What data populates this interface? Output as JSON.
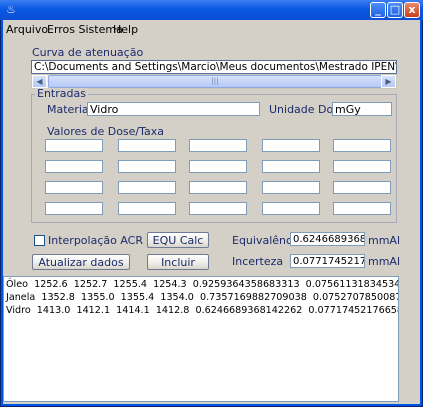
{
  "window": {
    "title": "",
    "icon": "java-cup-icon",
    "controls": {
      "minimize": "_",
      "maximize": "□",
      "close": "x"
    }
  },
  "menu": [
    "Arquivo",
    "Erros Sistema",
    "Help"
  ],
  "attenuation": {
    "label": "Curva de atenuação",
    "path": "C:\\Documents and Settings\\Marcio\\Meus documentos\\Mestrado IPEN\\Tubos\\Roerix\\Medida"
  },
  "inputs_panel": {
    "title": "Entradas",
    "material_label": "Material:",
    "material_value": "Vidro",
    "unit_label": "Unidade Dose:",
    "unit_value": "mGy",
    "values_label": "Valores de Dose/Taxa",
    "grid": [
      [
        "",
        "",
        "",
        "",
        ""
      ],
      [
        "",
        "",
        "",
        "",
        ""
      ],
      [
        "",
        "",
        "",
        "",
        ""
      ],
      [
        "",
        "",
        "",
        "",
        ""
      ]
    ]
  },
  "controls": {
    "interpolation_label": "Interpolação ACR",
    "interpolation_checked": false,
    "equ_calc_label": "EQU Calc",
    "update_label": "Atualizar dados",
    "include_label": "Incluir",
    "equivalence_label": "Equivalência",
    "equivalence_value": "0.624668936814226",
    "equivalence_unit": "mmAl",
    "uncertainty_label": "Incerteza",
    "uncertainty_value": "0.077174521766",
    "uncertainty_unit": "mmAl"
  },
  "results": [
    "Óleo  1252.6  1252.7  1255.4  1254.3  0.9259364358683313  0.07561131834534945  mG",
    "Janela  1352.8  1355.0  1355.4  1354.0  0.7357169882709038  0.07527078500870281  m",
    "Vidro  1413.0  1412.1  1414.1  1412.8  0.6246689368142262  0.07717452176658982  m"
  ],
  "colors": {
    "title_bar": "#0a58e3",
    "window_bg": "#d4d0c8",
    "label_navy": "#1c2b6b",
    "field_border": "#7f9db9"
  }
}
